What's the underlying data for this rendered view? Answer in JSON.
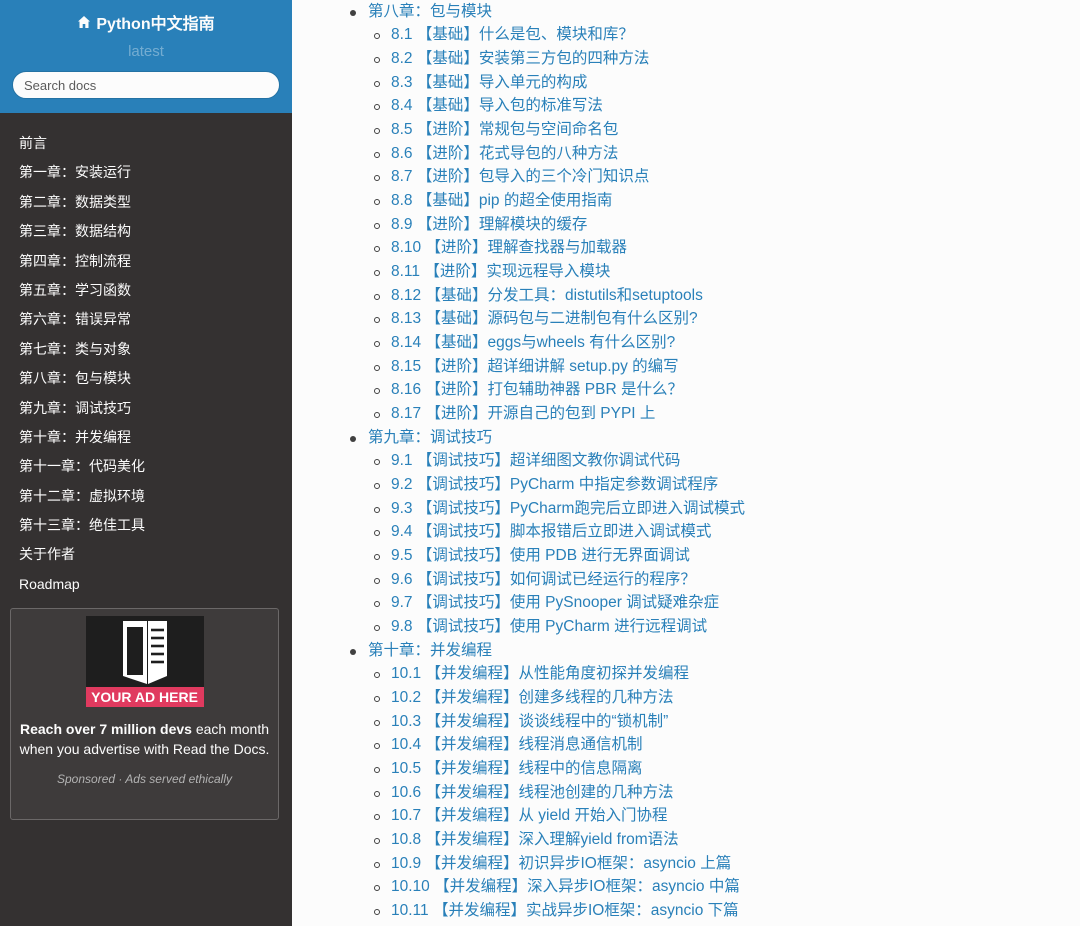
{
  "site": {
    "title": "Python中文指南",
    "version": "latest",
    "home_icon": "home-icon"
  },
  "search": {
    "placeholder": "Search docs"
  },
  "sidebar": {
    "items": [
      {
        "label": "前言"
      },
      {
        "label": "第一章：安装运行"
      },
      {
        "label": "第二章：数据类型"
      },
      {
        "label": "第三章：数据结构"
      },
      {
        "label": "第四章：控制流程"
      },
      {
        "label": "第五章：学习函数"
      },
      {
        "label": "第六章：错误异常"
      },
      {
        "label": "第七章：类与对象"
      },
      {
        "label": "第八章：包与模块"
      },
      {
        "label": "第九章：调试技巧"
      },
      {
        "label": "第十章：并发编程"
      },
      {
        "label": "第十一章：代码美化"
      },
      {
        "label": "第十二章：虚拟环境"
      },
      {
        "label": "第十三章：绝佳工具"
      },
      {
        "label": "关于作者"
      },
      {
        "label": "Roadmap"
      }
    ]
  },
  "ad": {
    "banner": "YOUR AD HERE",
    "bold_text": "Reach over 7 million devs",
    "text": " each month when you advertise with Read the Docs.",
    "footer": "Sponsored · Ads served ethically",
    "book_icon": "book-icon",
    "colors": {
      "banner": "#e03a5f"
    }
  },
  "content": {
    "chapters": [
      {
        "title": "第八章：包与模块",
        "sections": [
          "8.1 【基础】什么是包、模块和库？",
          "8.2 【基础】安装第三方包的四种方法",
          "8.3 【基础】导入单元的构成",
          "8.4 【基础】导入包的标准写法",
          "8.5 【进阶】常规包与空间命名包",
          "8.6 【进阶】花式导包的八种方法",
          "8.7 【进阶】包导入的三个冷门知识点",
          "8.8 【基础】pip 的超全使用指南",
          "8.9 【进阶】理解模块的缓存",
          "8.10 【进阶】理解查找器与加载器",
          "8.11 【进阶】实现远程导入模块",
          "8.12 【基础】分发工具：distutils和setuptools",
          "8.13 【基础】源码包与二进制包有什么区别?",
          "8.14 【基础】eggs与wheels 有什么区别?",
          "8.15 【进阶】超详细讲解 setup.py 的编写",
          "8.16 【进阶】打包辅助神器 PBR 是什么？",
          "8.17 【进阶】开源自己的包到 PYPI 上"
        ]
      },
      {
        "title": "第九章：调试技巧",
        "sections": [
          "9.1 【调试技巧】超详细图文教你调试代码",
          "9.2 【调试技巧】PyCharm 中指定参数调试程序",
          "9.3 【调试技巧】PyCharm跑完后立即进入调试模式",
          "9.4 【调试技巧】脚本报错后立即进入调试模式",
          "9.5 【调试技巧】使用 PDB 进行无界面调试",
          "9.6 【调试技巧】如何调试已经运行的程序？",
          "9.7 【调试技巧】使用 PySnooper 调试疑难杂症",
          "9.8 【调试技巧】使用 PyCharm 进行远程调试"
        ]
      },
      {
        "title": "第十章：并发编程",
        "sections": [
          "10.1 【并发编程】从性能角度初探并发编程",
          "10.2 【并发编程】创建多线程的几种方法",
          "10.3 【并发编程】谈谈线程中的“锁机制”",
          "10.4 【并发编程】线程消息通信机制",
          "10.5 【并发编程】线程中的信息隔离",
          "10.6 【并发编程】线程池创建的几种方法",
          "10.7 【并发编程】从 yield 开始入门协程",
          "10.8 【并发编程】深入理解yield from语法",
          "10.9 【并发编程】初识异步IO框架：asyncio 上篇",
          "10.10 【并发编程】深入异步IO框架：asyncio 中篇",
          "10.11 【并发编程】实战异步IO框架：asyncio 下篇"
        ]
      }
    ]
  },
  "colors": {
    "sidebar_bg": "#343131",
    "header_bg": "#2980b9",
    "link": "#2980b9",
    "content_bg": "#fcfcfc"
  }
}
